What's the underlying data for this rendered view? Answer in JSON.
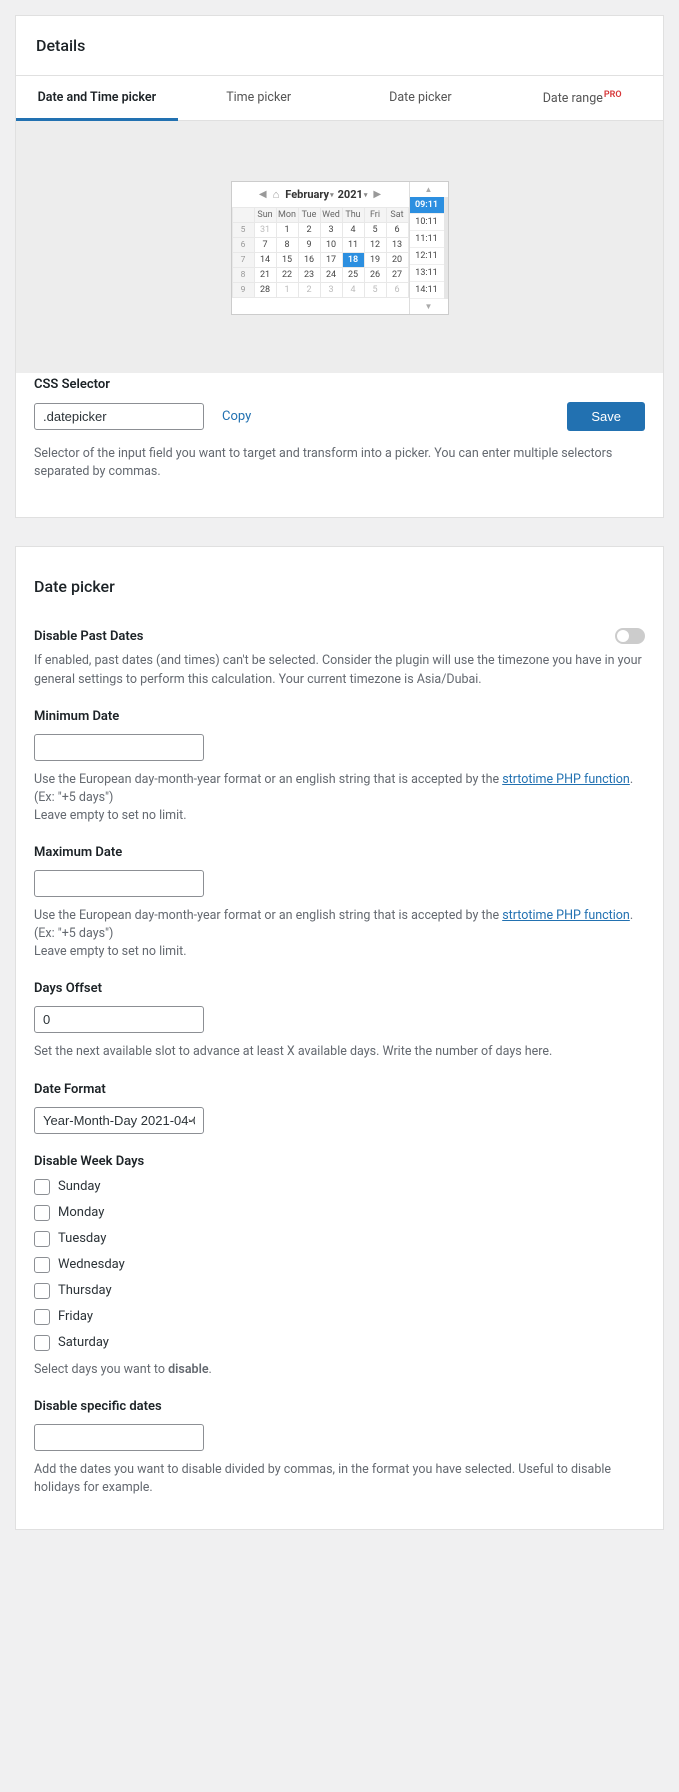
{
  "details": {
    "title": "Details",
    "tabs": [
      {
        "label": "Date and Time picker",
        "active": true
      },
      {
        "label": "Time picker",
        "active": false
      },
      {
        "label": "Date picker",
        "active": false
      },
      {
        "label": "Date range",
        "badge": "PRO",
        "active": false
      }
    ],
    "calendar": {
      "month": "February",
      "year": "2021",
      "weekdays": [
        "Sun",
        "Mon",
        "Tue",
        "Wed",
        "Thu",
        "Fri",
        "Sat"
      ],
      "rows": [
        {
          "wk": "5",
          "days": [
            "31",
            "1",
            "2",
            "3",
            "4",
            "5",
            "6"
          ],
          "dim": [
            0
          ]
        },
        {
          "wk": "6",
          "days": [
            "7",
            "8",
            "9",
            "10",
            "11",
            "12",
            "13"
          ]
        },
        {
          "wk": "7",
          "days": [
            "14",
            "15",
            "16",
            "17",
            "18",
            "19",
            "20"
          ],
          "sel": 4
        },
        {
          "wk": "8",
          "days": [
            "21",
            "22",
            "23",
            "24",
            "25",
            "26",
            "27"
          ]
        },
        {
          "wk": "9",
          "days": [
            "28",
            "1",
            "2",
            "3",
            "4",
            "5",
            "6"
          ],
          "dim": [
            1,
            2,
            3,
            4,
            5,
            6
          ]
        }
      ],
      "times": [
        "09:11",
        "10:11",
        "11:11",
        "12:11",
        "13:11",
        "14:11"
      ],
      "time_sel": 0
    },
    "css_selector": {
      "label": "CSS Selector",
      "value": ".datepicker",
      "copy": "Copy",
      "save": "Save",
      "help": "Selector of the input field you want to target and transform into a picker. You can enter multiple selectors separated by commas."
    }
  },
  "datepicker": {
    "title": "Date picker",
    "disable_past": {
      "label": "Disable Past Dates",
      "help": "If enabled, past dates (and times) can't be selected. Consider the plugin will use the timezone you have in your general settings to perform this calculation. Your current timezone is Asia/Dubai."
    },
    "min_date": {
      "label": "Minimum Date",
      "help_a": "Use the European day-month-year format or an english string that is accepted by the ",
      "link": "strtotime PHP function",
      "help_b": ". (Ex: \"+5 days\")",
      "help_c": "Leave empty to set no limit."
    },
    "max_date": {
      "label": "Maximum Date",
      "help_a": "Use the European day-month-year format or an english string that is accepted by the ",
      "link": "strtotime PHP function",
      "help_b": ". (Ex: \"+5 days\")",
      "help_c": "Leave empty to set no limit."
    },
    "days_offset": {
      "label": "Days Offset",
      "value": "0",
      "help": "Set the next available slot to advance at least X available days. Write the number of days here."
    },
    "date_format": {
      "label": "Date Format",
      "value": "Year-Month-Day 2021-04-0"
    },
    "disable_weekdays": {
      "label": "Disable Week Days",
      "days": [
        "Sunday",
        "Monday",
        "Tuesday",
        "Wednesday",
        "Thursday",
        "Friday",
        "Saturday"
      ],
      "help_a": "Select days you want to ",
      "help_b": "disable",
      "help_c": "."
    },
    "disable_specific": {
      "label": "Disable specific dates",
      "help": "Add the dates you want to disable divided by commas, in the format you have selected. Useful to disable holidays for example."
    }
  }
}
